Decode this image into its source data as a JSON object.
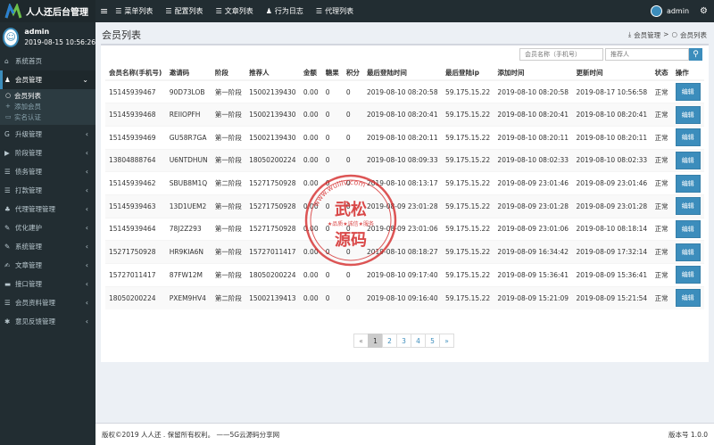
{
  "app": {
    "title": "人人还后台管理"
  },
  "topnav": {
    "items": [
      {
        "label": "菜单列表",
        "icon": "list-icon"
      },
      {
        "label": "配置列表",
        "icon": "list-icon"
      },
      {
        "label": "文章列表",
        "icon": "list-icon"
      },
      {
        "label": "行为日志",
        "icon": "user-icon"
      },
      {
        "label": "代理列表",
        "icon": "list-icon"
      }
    ],
    "username": "admin"
  },
  "sidebar": {
    "user": {
      "name": "admin",
      "time": "2019-08-15 10:56:26"
    },
    "items": [
      {
        "label": "系统首页",
        "icon": "home-icon"
      },
      {
        "label": "会员管理",
        "icon": "user-icon",
        "expanded": true
      },
      {
        "label": "升级管理",
        "icon": "g-plus-icon"
      },
      {
        "label": "阶段管理",
        "icon": "play-icon"
      },
      {
        "label": "债务管理",
        "icon": "list-icon"
      },
      {
        "label": "打款管理",
        "icon": "list-icon"
      },
      {
        "label": "代理管理管理",
        "icon": "users-icon"
      },
      {
        "label": "优化建护",
        "icon": "wrench-icon"
      },
      {
        "label": "系统管理",
        "icon": "wrench-icon"
      },
      {
        "label": "文章管理",
        "icon": "edit-icon"
      },
      {
        "label": "接口管理",
        "icon": "folder-icon"
      },
      {
        "label": "会员资料管理",
        "icon": "list-icon"
      },
      {
        "label": "意见反馈管理",
        "icon": "asterisk-icon"
      }
    ],
    "sub_items": [
      {
        "label": "会员列表"
      },
      {
        "label": "添加会员"
      },
      {
        "label": "实名认证"
      }
    ]
  },
  "page": {
    "title": "会员列表",
    "breadcrumb": [
      "会员管理",
      ">",
      "会员列表"
    ]
  },
  "search": {
    "placeholder1": "会员名称（手机号）",
    "placeholder2": "推荐人"
  },
  "table": {
    "headers": [
      "会员名称(手机号)",
      "邀请码",
      "阶段",
      "推荐人",
      "金额",
      "糖果",
      "积分",
      "最后登陆时间",
      "最后登陆ip",
      "添加时间",
      "更新时间",
      "状态",
      "操作"
    ],
    "rows": [
      [
        "15145939467",
        "90D73LOB",
        "第一阶段",
        "15002139430",
        "0.00",
        "0",
        "0",
        "2019-08-10 08:20:58",
        "59.175.15.22",
        "2019-08-10 08:20:58",
        "2019-08-17 10:56:58",
        "正常",
        "编辑"
      ],
      [
        "15145939468",
        "REIIOPFH",
        "第一阶段",
        "15002139430",
        "0.00",
        "0",
        "0",
        "2019-08-10 08:20:41",
        "59.175.15.22",
        "2019-08-10 08:20:41",
        "2019-08-10 08:20:41",
        "正常",
        "编辑"
      ],
      [
        "15145939469",
        "GU58R7GA",
        "第一阶段",
        "15002139430",
        "0.00",
        "0",
        "0",
        "2019-08-10 08:20:11",
        "59.175.15.22",
        "2019-08-10 08:20:11",
        "2019-08-10 08:20:11",
        "正常",
        "编辑"
      ],
      [
        "13804888764",
        "U6NTDHUN",
        "第一阶段",
        "18050200224",
        "0.00",
        "0",
        "0",
        "2019-08-10 08:09:33",
        "59.175.15.22",
        "2019-08-10 08:02:33",
        "2019-08-10 08:02:33",
        "正常",
        "编辑"
      ],
      [
        "15145939462",
        "SBUB8M1Q",
        "第二阶段",
        "15271750928",
        "0.00",
        "0",
        "0",
        "2019-08-10 08:13:17",
        "59.175.15.22",
        "2019-08-09 23:01:46",
        "2019-08-09 23:01:46",
        "正常",
        "编辑"
      ],
      [
        "15145939463",
        "13D1UEM2",
        "第一阶段",
        "15271750928",
        "0.00",
        "0",
        "0",
        "2019-08-09 23:01:28",
        "59.175.15.22",
        "2019-08-09 23:01:28",
        "2019-08-09 23:01:28",
        "正常",
        "编辑"
      ],
      [
        "15145939464",
        "78J2Z293",
        "第一阶段",
        "15271750928",
        "0.00",
        "0",
        "0",
        "2019-08-09 23:01:06",
        "59.175.15.22",
        "2019-08-09 23:01:06",
        "2019-08-10 08:18:14",
        "正常",
        "编辑"
      ],
      [
        "15271750928",
        "HR9KIA6N",
        "第一阶段",
        "15727011417",
        "0.00",
        "0",
        "0",
        "2019-08-10 08:18:27",
        "59.175.15.22",
        "2019-08-09 16:34:42",
        "2019-08-09 17:32:14",
        "正常",
        "编辑"
      ],
      [
        "15727011417",
        "87FW12M",
        "第一阶段",
        "18050200224",
        "0.00",
        "0",
        "0",
        "2019-08-10 09:17:40",
        "59.175.15.22",
        "2019-08-09 15:36:41",
        "2019-08-09 15:36:41",
        "正常",
        "编辑"
      ],
      [
        "18050200224",
        "PXEM9HV4",
        "第二阶段",
        "15002139413",
        "0.00",
        "0",
        "0",
        "2019-08-10 09:16:40",
        "59.175.15.22",
        "2019-08-09 15:21:09",
        "2019-08-09 15:21:54",
        "正常",
        "编辑"
      ]
    ]
  },
  "pagination": {
    "prev": "«",
    "pages": [
      "1",
      "2",
      "3",
      "4",
      "5"
    ],
    "next": "»",
    "current": "1"
  },
  "footer": {
    "copyright": "版权©2019 人人还 . 保留所有权利。 ——5G云源码分享网",
    "version": "版本号 1.0.0"
  },
  "watermark": {
    "url": "www.wulilv.com",
    "main_text_top": "武松",
    "main_text_bottom": "源码",
    "slogan": "★品质★诚信★服务"
  },
  "colors": {
    "sidebar_bg": "#222d32",
    "accent": "#3c8dbc",
    "content_bg": "#ecf0f5"
  }
}
